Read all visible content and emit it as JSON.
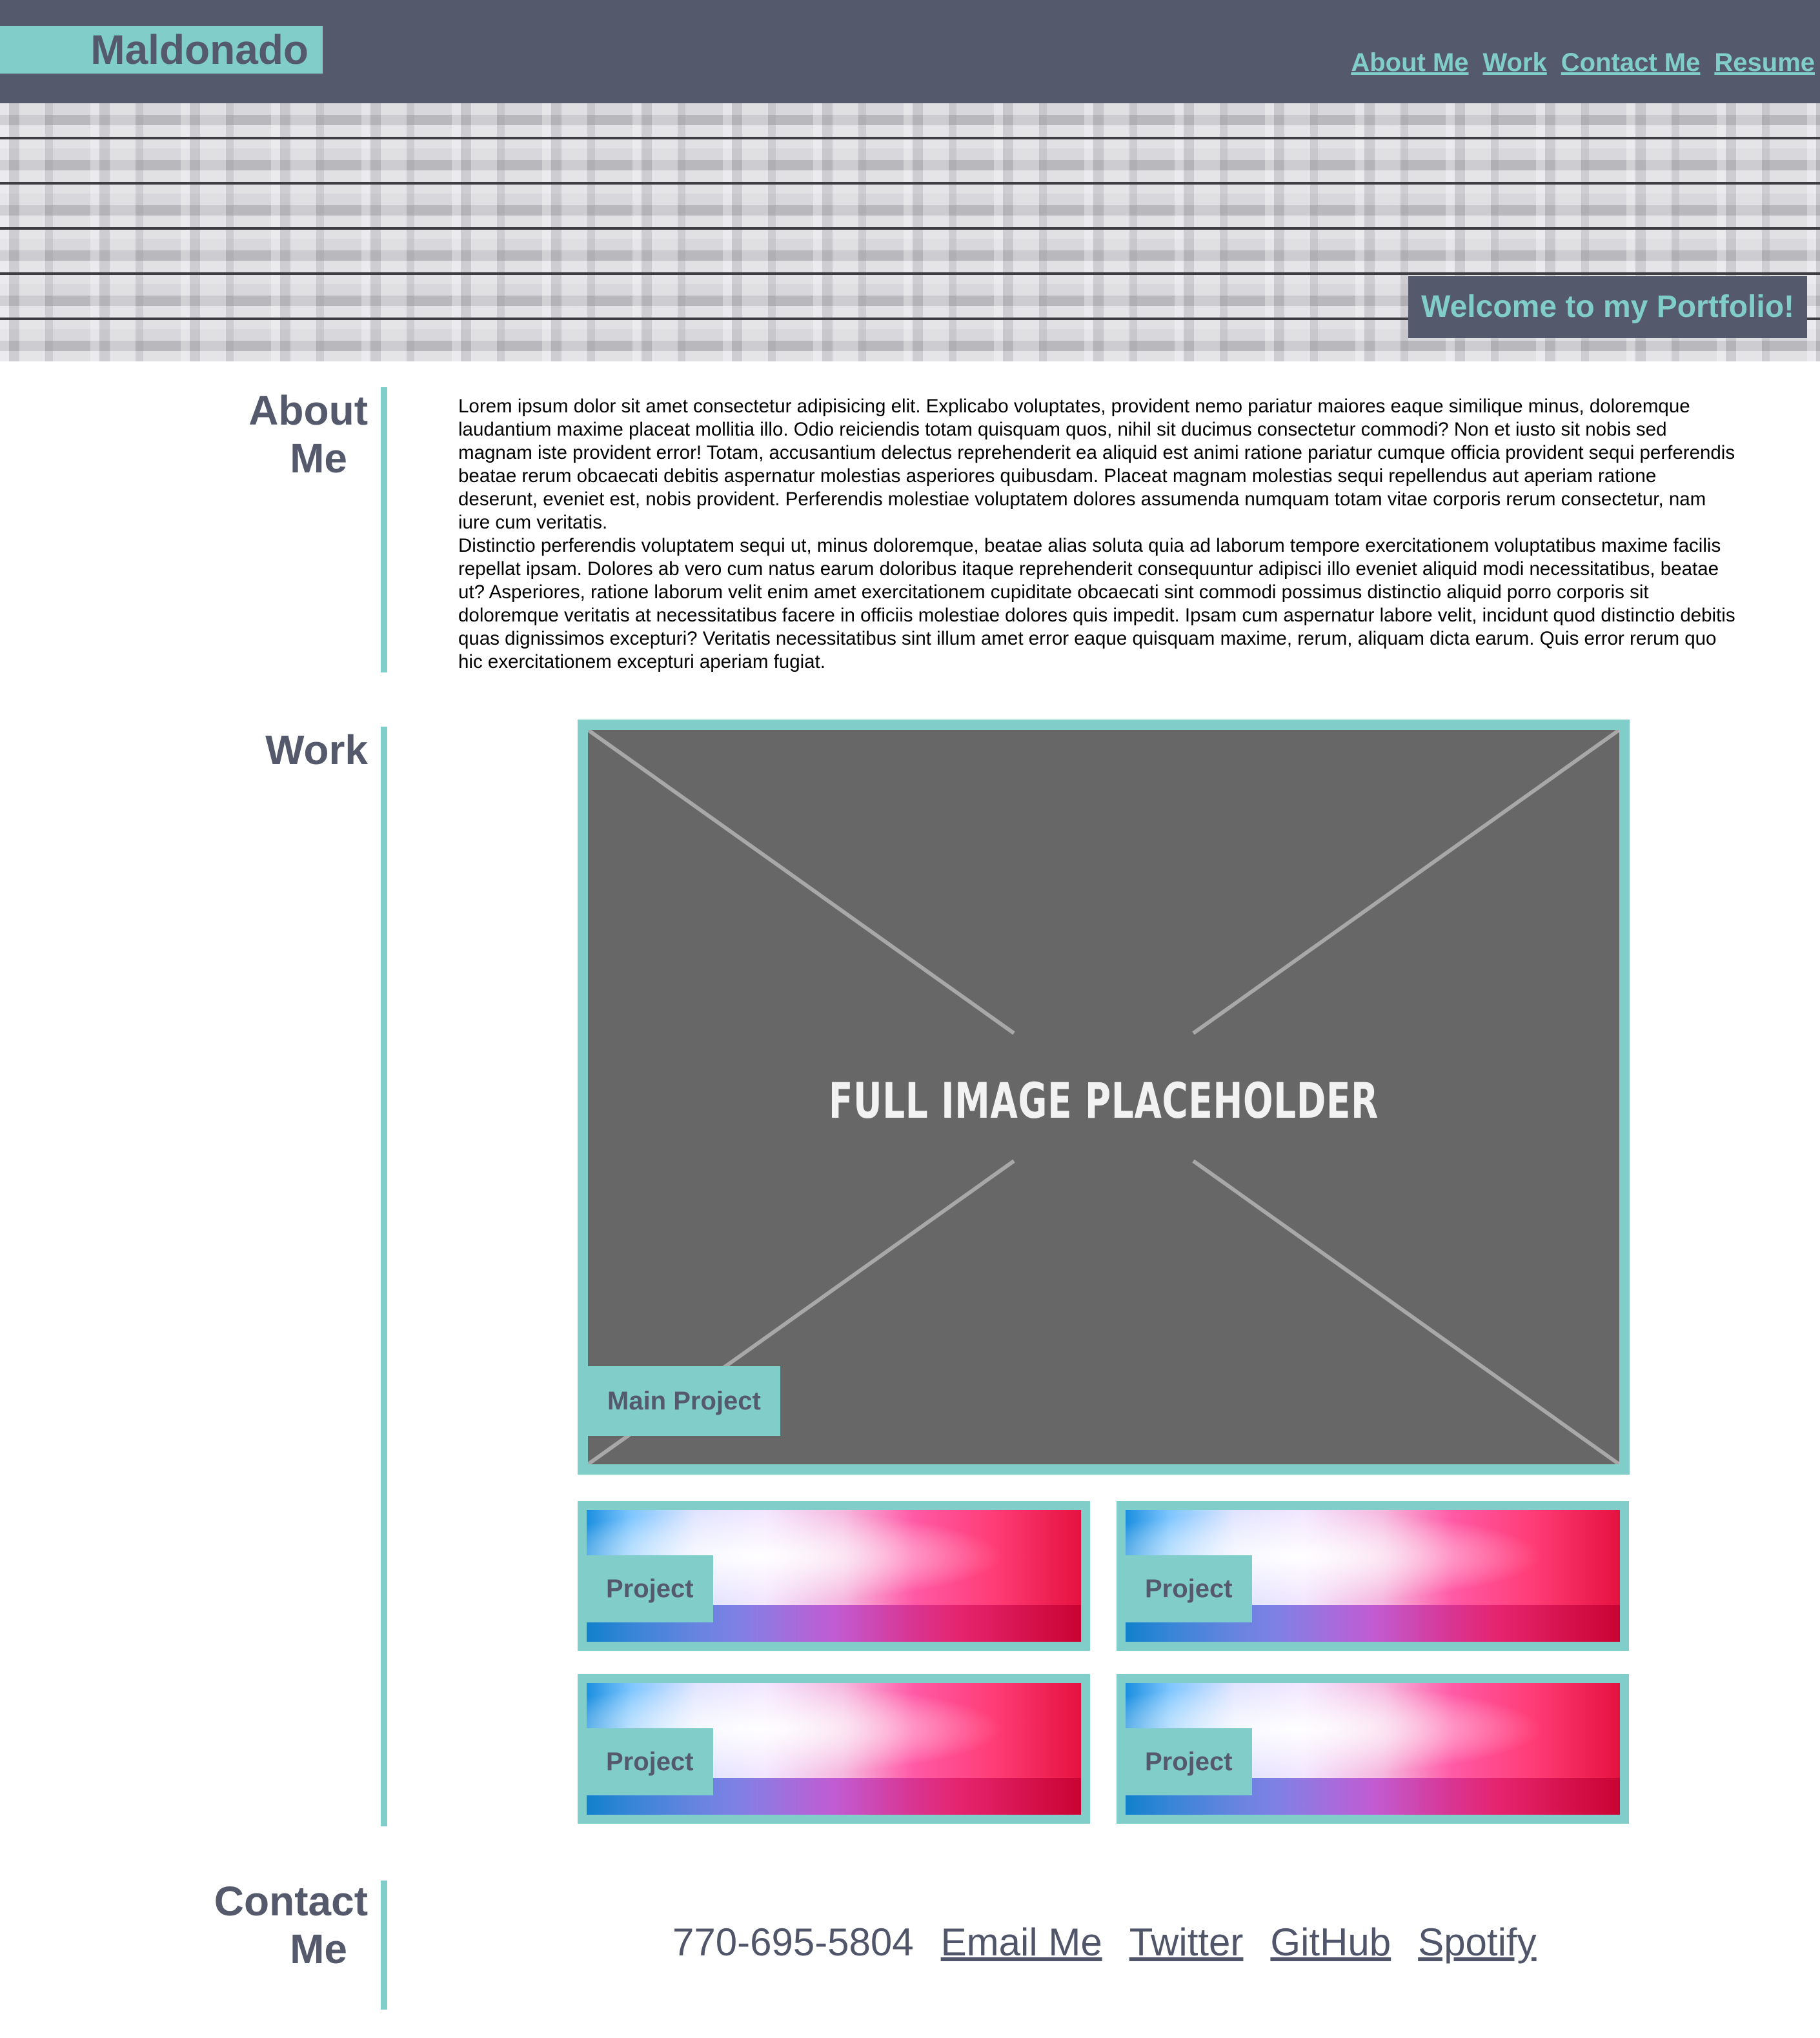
{
  "header": {
    "brand": "Maldonado",
    "nav": [
      "About Me",
      "Work",
      "Contact Me",
      "Resume"
    ]
  },
  "hero": {
    "banner": "Welcome to my Portfolio!"
  },
  "about": {
    "title_line1": "About",
    "title_line2": "Me",
    "paragraph1": "Lorem ipsum dolor sit amet consectetur adipisicing elit. Explicabo voluptates, provident nemo pariatur maiores eaque similique minus, doloremque laudantium maxime placeat mollitia illo. Odio reiciendis totam quisquam quos, nihil sit ducimus consectetur commodi? Non et iusto sit nobis sed magnam iste provident error! Totam, accusantium delectus reprehenderit ea aliquid est animi ratione pariatur cumque officia provident sequi perferendis beatae rerum obcaecati debitis aspernatur molestias asperiores quibusdam. Placeat magnam molestias sequi repellendus aut aperiam ratione deserunt, eveniet est, nobis provident. Perferendis molestiae voluptatem dolores assumenda numquam totam vitae corporis rerum consectetur, nam iure cum veritatis.",
    "paragraph2": "Distinctio perferendis voluptatem sequi ut, minus doloremque, beatae alias soluta quia ad laborum tempore exercitationem voluptatibus maxime facilis repellat ipsam. Dolores ab vero cum natus earum doloribus itaque reprehenderit consequuntur adipisci illo eveniet aliquid modi necessitatibus, beatae ut? Asperiores, ratione laborum velit enim amet exercitationem cupiditate obcaecati sint commodi possimus distinctio aliquid porro corporis sit doloremque veritatis at necessitatibus facere in officiis molestiae dolores quis impedit. Ipsam cum aspernatur labore velit, incidunt quod distinctio debitis quas dignissimos excepturi? Veritatis necessitatibus sint illum amet error eaque quisquam maxime, rerum, aliquam dicta earum. Quis error rerum quo hic exercitationem excepturi aperiam fugiat."
  },
  "work": {
    "title": "Work",
    "main_project": {
      "placeholder_text": "FULL IMAGE PLACEHOLDER",
      "label": "Main Project"
    },
    "projects": [
      {
        "label": "Project"
      },
      {
        "label": "Project"
      },
      {
        "label": "Project"
      },
      {
        "label": "Project"
      }
    ]
  },
  "contact": {
    "title_line1": "Contact",
    "title_line2": "Me",
    "phone": "770-695-5804",
    "links": [
      "Email Me",
      "Twitter",
      "GitHub",
      "Spotify"
    ]
  },
  "colors": {
    "accent": "#81cdca",
    "dark": "#545a6c",
    "placeholder_gray": "#676767"
  }
}
